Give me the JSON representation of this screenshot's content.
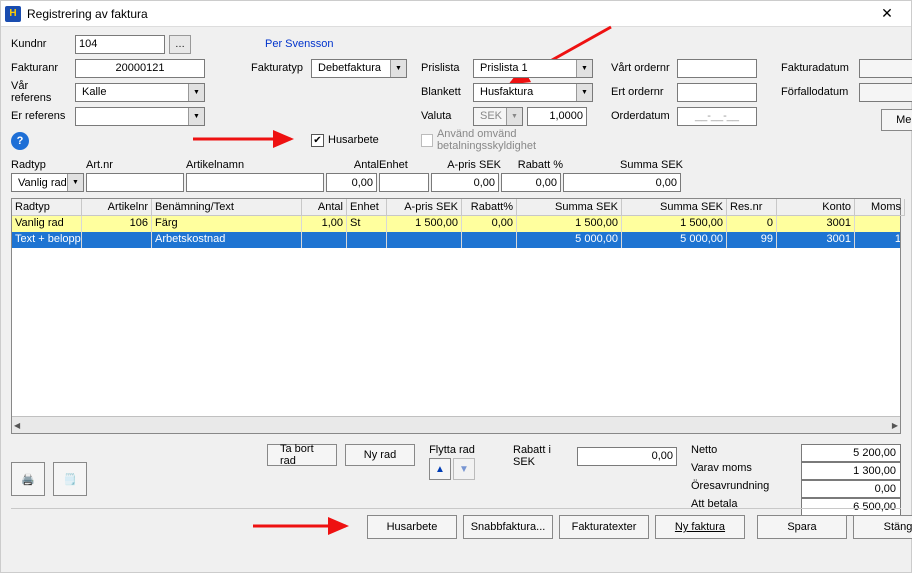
{
  "window": {
    "title": "Registrering av faktura"
  },
  "customer": {
    "label": "Kundnr",
    "value": "104",
    "name": "Per Svensson"
  },
  "invoice_no": {
    "label": "Fakturanr",
    "value": "20000121"
  },
  "our_ref": {
    "label": "Vår referens",
    "value": "Kalle"
  },
  "their_ref": {
    "label": "Er referens",
    "value": ""
  },
  "invoice_type": {
    "label": "Fakturatyp",
    "value": "Debetfaktura"
  },
  "pricelist": {
    "label": "Prislista",
    "value": "Prislista 1"
  },
  "blankett": {
    "label": "Blankett",
    "value": "Husfaktura"
  },
  "currency": {
    "label": "Valuta",
    "value": "SEK",
    "rate": "1,0000"
  },
  "our_order": {
    "label": "Vårt ordernr",
    "value": ""
  },
  "their_order": {
    "label": "Ert ordernr",
    "value": ""
  },
  "orderdate": {
    "label": "Orderdatum",
    "value": "__-__-__"
  },
  "invoicedate": {
    "label": "Fakturadatum",
    "value": ""
  },
  "duedate": {
    "label": "Förfallodatum",
    "value": ""
  },
  "moreinfo_btn": "Mer info",
  "husarbete_check": "Husarbete",
  "reverse_vat_check": "Använd omvänd betalningsskyldighet",
  "entry_headers": {
    "radtyp": "Radtyp",
    "artnr": "Art.nr",
    "artnamn": "Artikelnamn",
    "antal": "Antal",
    "enhet": "Enhet",
    "apris": "A-pris SEK",
    "rabatt": "Rabatt %",
    "summa": "Summa SEK"
  },
  "entry_row": {
    "radtyp": "Vanlig rad",
    "artnr": "",
    "artnamn": "",
    "antal": "0,00",
    "enhet": "",
    "apris": "0,00",
    "rabatt": "0,00",
    "summa": "0,00"
  },
  "table": {
    "headers": {
      "radtyp": "Radtyp",
      "artnr": "Artikelnr",
      "benamning": "Benämning/Text",
      "antal": "Antal",
      "enhet": "Enhet",
      "apris": "A-pris SEK",
      "rabatt": "Rabatt%",
      "summa1": "Summa SEK",
      "summa2": "Summa SEK",
      "resnr": "Res.nr",
      "konto": "Konto",
      "moms": "Moms"
    },
    "rows": [
      {
        "radtyp": "Vanlig rad",
        "artnr": "106",
        "benamning": "Färg",
        "antal": "1,00",
        "enhet": "St",
        "apris": "1 500,00",
        "rabatt": "0,00",
        "summa1": "1 500,00",
        "summa2": "1 500,00",
        "resnr": "0",
        "konto": "3001",
        "moms": ""
      },
      {
        "radtyp": "Text + belopp",
        "artnr": "",
        "benamning": "Arbetskostnad",
        "antal": "",
        "enhet": "",
        "apris": "",
        "rabatt": "",
        "summa1": "5 000,00",
        "summa2": "5 000,00",
        "resnr": "99",
        "konto": "3001",
        "moms": "1"
      }
    ]
  },
  "flytta_label": "Flytta rad",
  "ta_bort_btn": "Ta bort rad",
  "ny_rad_btn": "Ny rad",
  "rabatt_sek": {
    "label": "Rabatt i SEK",
    "value": "0,00"
  },
  "totals": {
    "netto_label": "Netto",
    "netto": "5 200,00",
    "moms_label": "Varav moms",
    "moms": "1 300,00",
    "ores_label": "Öresavrundning",
    "ores": "0,00",
    "att_label": "Att betala",
    "att": "6 500,00"
  },
  "bottom_buttons": {
    "husarbete": "Husarbete",
    "snabb": "Snabbfaktura...",
    "texter": "Fakturatexter",
    "ny": "Ny faktura",
    "spara": "Spara",
    "stang": "Stäng"
  }
}
